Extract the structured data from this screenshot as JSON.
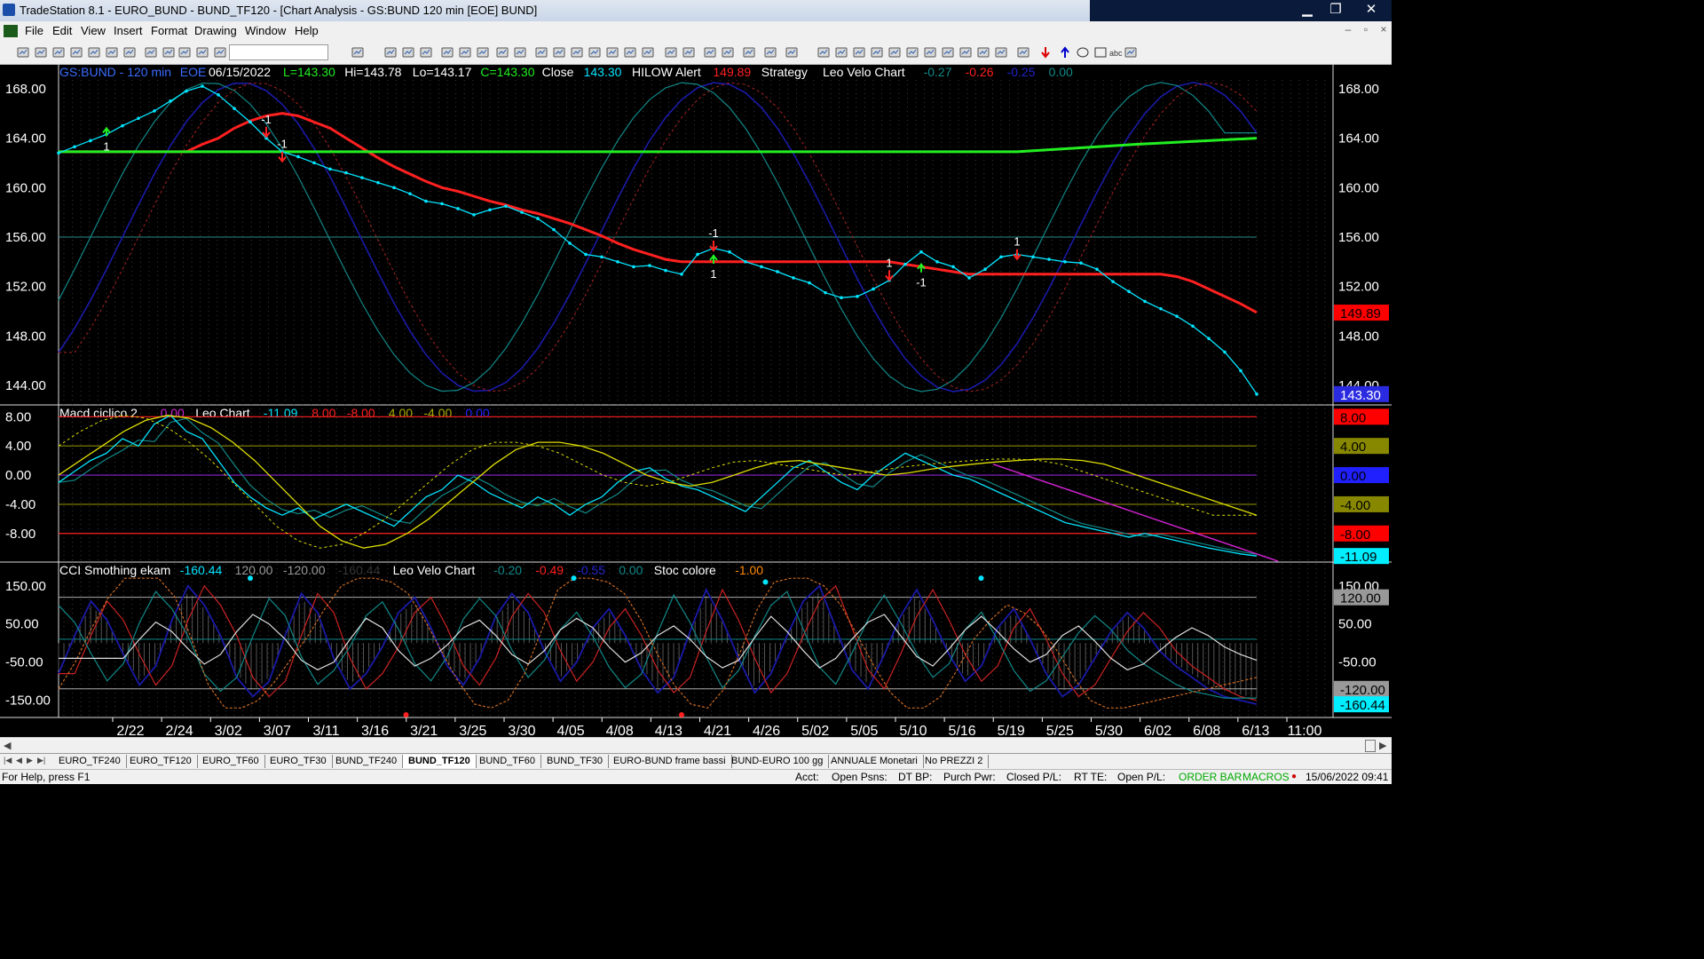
{
  "window": {
    "title": "TradeStation 8.1 - EURO_BUND - BUND_TF120 - [Chart Analysis - GS:BUND  120 min  [EOE] BUND]",
    "minimize": "▁",
    "restore": "❐",
    "close": "✕"
  },
  "menu": [
    "File",
    "Edit",
    "View",
    "Insert",
    "Format",
    "Drawing",
    "Window",
    "Help"
  ],
  "colors": {
    "bg": "#000000",
    "price": "#00e5ff",
    "red": "#ff2020",
    "green": "#22ee22",
    "navy": "#1a1aa8",
    "teal": "#118888",
    "yellow": "#dddd00",
    "magenta": "#cc22cc"
  },
  "chart_data": [
    {
      "type": "line",
      "panel": "price",
      "header": [
        {
          "text": "GS:BUND - 120 min",
          "color": "#3a6cff"
        },
        {
          "text": "EOE",
          "color": "#3a6cff"
        },
        {
          "text": "06/15/2022",
          "color": "#ffffff"
        },
        {
          "text": "L=143.30",
          "color": "#22ee22"
        },
        {
          "text": "Hi=143.78",
          "color": "#ffffff"
        },
        {
          "text": "Lo=143.17",
          "color": "#ffffff"
        },
        {
          "text": "C=143.30",
          "color": "#22ee22"
        },
        {
          "text": "Close",
          "color": "#ffffff"
        },
        {
          "text": "143.30",
          "color": "#00e5ff"
        },
        {
          "text": "HILOW Alert",
          "color": "#ffffff"
        },
        {
          "text": "149.89",
          "color": "#ff2020"
        },
        {
          "text": "Strategy",
          "color": "#ffffff"
        },
        {
          "text": "Leo Velo Chart",
          "color": "#ffffff"
        },
        {
          "text": "-0.27",
          "color": "#118888"
        },
        {
          "text": "-0.26",
          "color": "#ff2020"
        },
        {
          "text": "-0.25",
          "color": "#2222cc"
        },
        {
          "text": "0.00",
          "color": "#118888"
        }
      ],
      "ylim": [
        142.5,
        170.0
      ],
      "yticks": [
        "168.00",
        "164.00",
        "160.00",
        "156.00",
        "152.00",
        "148.00",
        "144.00"
      ],
      "ytick_values": [
        168,
        164,
        160,
        156,
        152,
        148,
        144
      ],
      "right_badges": [
        {
          "text": "149.89",
          "value": 149.89,
          "bg": "#ff0000",
          "fg": "#000000"
        },
        {
          "text": "143.30",
          "value": 143.3,
          "bg": "#2a2ae0",
          "fg": "#ffffff"
        }
      ],
      "hline": 156.0,
      "series": [
        {
          "name": "Close",
          "values": [
            162.8,
            163.3,
            163.8,
            164.3,
            165.0,
            165.6,
            166.2,
            167.0,
            167.8,
            168.2,
            167.5,
            166.4,
            165.3,
            164.0,
            162.9,
            162.5,
            162.0,
            161.5,
            161.2,
            160.8,
            160.4,
            160.0,
            159.5,
            158.9,
            158.7,
            158.3,
            157.8,
            158.2,
            158.5,
            158.0,
            157.5,
            156.6,
            155.5,
            154.6,
            154.4,
            154.0,
            153.6,
            153.7,
            153.3,
            153.0,
            154.6,
            155.1,
            154.8,
            154.0,
            153.6,
            153.2,
            152.7,
            152.3,
            151.5,
            151.1,
            151.2,
            151.8,
            152.5,
            153.8,
            154.8,
            154.0,
            153.6,
            152.7,
            153.4,
            154.4,
            154.6,
            154.4,
            154.2,
            154.0,
            153.9,
            153.4,
            152.4,
            151.6,
            150.8,
            150.2,
            149.6,
            148.8,
            147.8,
            146.7,
            145.2,
            143.3
          ]
        },
        {
          "name": "Red Strategy",
          "values": [
            162.9,
            162.9,
            162.9,
            162.9,
            162.9,
            162.9,
            162.9,
            162.9,
            162.9,
            163.5,
            164.0,
            164.8,
            165.4,
            165.8,
            166.0,
            165.8,
            165.3,
            164.8,
            164.0,
            163.2,
            162.4,
            161.7,
            161.1,
            160.5,
            160.0,
            159.7,
            159.3,
            158.9,
            158.6,
            158.2,
            157.9,
            157.5,
            157.1,
            156.6,
            156.1,
            155.5,
            155.0,
            154.6,
            154.2,
            154.0,
            154.0,
            154.0,
            154.0,
            154.0,
            154.0,
            154.0,
            154.0,
            154.0,
            154.0,
            154.0,
            154.0,
            154.0,
            154.0,
            153.8,
            153.6,
            153.4,
            153.2,
            153.0,
            153.0,
            153.0,
            153.0,
            153.0,
            153.0,
            153.0,
            153.0,
            153.0,
            153.0,
            153.0,
            153.0,
            153.0,
            152.8,
            152.4,
            151.8,
            151.2,
            150.6,
            149.9
          ]
        }
      ],
      "markers": [
        "1",
        "-1",
        "-1",
        "1",
        "1",
        "-1",
        "1",
        "-1"
      ],
      "xticks": [
        "2/22",
        "2/24",
        "3/02",
        "3/07",
        "3/11",
        "3/16",
        "3/21",
        "3/25",
        "3/30",
        "4/05",
        "4/08",
        "4/13",
        "4/21",
        "4/26",
        "5/02",
        "5/05",
        "5/10",
        "5/16",
        "5/19",
        "5/25",
        "5/30",
        "6/02",
        "6/08",
        "6/13",
        "11:00"
      ]
    },
    {
      "type": "line",
      "panel": "macd",
      "header": [
        {
          "text": "Macd ciclico 2",
          "color": "#ffffff"
        },
        {
          "text": "0.00",
          "color": "#cc22cc"
        },
        {
          "text": "Leo Chart",
          "color": "#ffffff"
        },
        {
          "text": "-11.09",
          "color": "#00e5ff"
        },
        {
          "text": "8.00",
          "color": "#ff2020"
        },
        {
          "text": "-8.00",
          "color": "#ff2020"
        },
        {
          "text": "4.00",
          "color": "#aaaa00"
        },
        {
          "text": "-4.00",
          "color": "#aaaa00"
        },
        {
          "text": "0.00",
          "color": "#2222ff"
        }
      ],
      "ylim": [
        -11.8,
        9.5
      ],
      "yticks": [
        "8.00",
        "4.00",
        "0.00",
        "-4.00",
        "-8.00"
      ],
      "ytick_values": [
        8,
        4,
        0,
        -4,
        -8
      ],
      "right_badges": [
        {
          "text": "8.00",
          "value": 8,
          "bg": "#ff0000",
          "fg": "#000000"
        },
        {
          "text": "4.00",
          "value": 4,
          "bg": "#888800",
          "fg": "#000000"
        },
        {
          "text": "0.00",
          "value": 0,
          "bg": "#2020ff",
          "fg": "#000000"
        },
        {
          "text": "-4.00",
          "value": -4,
          "bg": "#888800",
          "fg": "#000000"
        },
        {
          "text": "-8.00",
          "value": -8,
          "bg": "#ff0000",
          "fg": "#000000"
        },
        {
          "text": "-11.09",
          "value": -11.09,
          "bg": "#00eeff",
          "fg": "#000000"
        }
      ],
      "series": [
        {
          "name": "Leo Chart",
          "values": [
            -1.0,
            0.5,
            2.0,
            3.0,
            5.0,
            4.0,
            7.0,
            8.2,
            6.0,
            5.0,
            2.0,
            -1.0,
            -3.0,
            -4.5,
            -5.5,
            -4.5,
            -6.0,
            -5.0,
            -4.0,
            -5.0,
            -6.0,
            -7.0,
            -5.0,
            -3.0,
            -2.0,
            0.0,
            -1.0,
            -2.5,
            -3.5,
            -4.5,
            -3.0,
            -4.0,
            -5.5,
            -4.0,
            -3.0,
            -1.0,
            0.5,
            1.0,
            -0.5,
            -1.5,
            -2.0,
            -3.0,
            -4.0,
            -5.0,
            -3.0,
            -1.0,
            1.0,
            2.0,
            0.5,
            -1.0,
            -2.0,
            0.0,
            1.5,
            3.0,
            2.0,
            1.0,
            0.0,
            -0.5,
            -1.5,
            -2.5,
            -3.5,
            -4.5,
            -5.5,
            -6.5,
            -7.0,
            -7.5,
            -8.0,
            -8.5,
            -8.0,
            -8.5,
            -9.0,
            -9.5,
            -10.0,
            -10.4,
            -10.8,
            -11.1
          ]
        },
        {
          "name": "Yellow",
          "values": [
            0.0,
            2.0,
            4.0,
            6.0,
            7.5,
            8.2,
            7.8,
            6.5,
            4.5,
            2.0,
            -1.0,
            -4.0,
            -7.0,
            -9.0,
            -10.0,
            -9.5,
            -8.0,
            -6.0,
            -3.5,
            -1.0,
            1.5,
            3.5,
            4.5,
            4.5,
            4.0,
            3.0,
            1.5,
            0.0,
            -1.0,
            -1.5,
            -1.0,
            0.0,
            1.0,
            1.8,
            2.0,
            1.5,
            1.0,
            0.5,
            0.0,
            0.3,
            0.8,
            1.2,
            1.5,
            1.8,
            2.0,
            2.2,
            2.2,
            2.0,
            1.5,
            0.5,
            -0.5,
            -1.5,
            -2.5,
            -3.5,
            -4.5,
            -5.5
          ]
        }
      ],
      "trend": {
        "name": "Magenta trend",
        "from": 1.5,
        "to": -11.8
      }
    },
    {
      "type": "line",
      "panel": "cci",
      "header": [
        {
          "text": "CCI Smothing ekam",
          "color": "#ffffff"
        },
        {
          "text": "-160.44",
          "color": "#00e5ff"
        },
        {
          "text": "120.00",
          "color": "#999999"
        },
        {
          "text": "-120.00",
          "color": "#999999"
        },
        {
          "text": "-160.44",
          "color": "#333333"
        },
        {
          "text": "Leo Velo Chart",
          "color": "#ffffff"
        },
        {
          "text": "-0.20",
          "color": "#118888"
        },
        {
          "text": "-0.49",
          "color": "#ff2020"
        },
        {
          "text": "-0.55",
          "color": "#2222cc"
        },
        {
          "text": "0.00",
          "color": "#118888"
        },
        {
          "text": "Stoc colore",
          "color": "#ffffff"
        },
        {
          "text": "-1.00",
          "color": "#ff8800"
        }
      ],
      "ylim": [
        -195,
        210
      ],
      "yticks": [
        "150.00",
        "50.00",
        "-50.00",
        "-150.00"
      ],
      "ytick_values": [
        150,
        50,
        -50,
        -150
      ],
      "right_badges": [
        {
          "text": "120.00",
          "value": 120,
          "bg": "#999999",
          "fg": "#000000"
        },
        {
          "text": "-120.00",
          "value": -120,
          "bg": "#999999",
          "fg": "#000000"
        },
        {
          "text": "-160.44",
          "value": -160.44,
          "bg": "#00eeff",
          "fg": "#000000"
        }
      ],
      "series": [
        {
          "name": "CCI",
          "values": [
            -80,
            20,
            110,
            60,
            -30,
            -110,
            -60,
            60,
            150,
            100,
            20,
            -90,
            -140,
            -100,
            20,
            130,
            80,
            -40,
            -120,
            -80,
            -10,
            80,
            120,
            40,
            -60,
            -110,
            -40,
            70,
            130,
            80,
            -20,
            -100,
            -50,
            40,
            90,
            20,
            -70,
            -130,
            -90,
            30,
            140,
            60,
            -40,
            -130,
            -80,
            20,
            110,
            150,
            40,
            -70,
            -120,
            -30,
            70,
            140,
            60,
            -30,
            -100,
            -60,
            40,
            90,
            10,
            -80,
            -140,
            -110,
            -40,
            30,
            80,
            40,
            -20,
            -60,
            -90,
            -120,
            -140,
            -150,
            -160
          ]
        },
        {
          "name": "Stoc colore",
          "values": [
            -120,
            -50,
            40,
            120,
            170,
            170,
            170,
            120,
            10,
            -110,
            -170,
            -170,
            -150,
            -100,
            -40,
            20,
            90,
            150,
            170,
            170,
            160,
            130,
            60,
            -20,
            -100,
            -160,
            -170,
            -150,
            -80,
            30,
            140,
            170,
            170,
            160,
            130,
            60,
            -30,
            -110,
            -160,
            -170,
            -120,
            -20,
            90,
            160,
            170,
            170,
            150,
            100,
            20,
            -60,
            -130,
            -170,
            -170,
            -140,
            -70,
            10,
            60,
            100,
            80,
            40,
            -20,
            -90,
            -150,
            -170,
            -170,
            -160,
            -150,
            -140,
            -130,
            -120,
            -110,
            -100,
            -90
          ]
        }
      ],
      "hlines": [
        120,
        -120,
        10
      ]
    }
  ],
  "tabs": {
    "items": [
      "EURO_TF240",
      "EURO_TF120",
      "EURO_TF60",
      "EURO_TF30",
      "BUND_TF240",
      "BUND_TF120",
      "BUND_TF60",
      "BUND_TF30",
      "EURO-BUND frame bassi",
      "BUND-EURO 100 gg",
      "ANNUALE Monetari",
      "No PREZZI 2"
    ],
    "active_index": 5
  },
  "status": {
    "help": "For Help, press F1",
    "acct": "Acct:",
    "open_psns": "Open Psns:",
    "dt_bp": "DT BP:",
    "purch_pwr": "Purch Pwr:",
    "closed_pl": "Closed P/L:",
    "rt_te": "RT TE:",
    "open_pl": "Open P/L:",
    "order_bar": "ORDER BAR",
    "macros": "MACROS",
    "datetime": "15/06/2022 09:41"
  }
}
